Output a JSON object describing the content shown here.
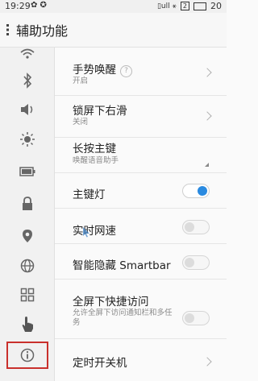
{
  "status_bar": {
    "time": "19:29",
    "notif_glyph": "✿ ✪",
    "signal_text": "▯ull ⚹",
    "sim_badge": "2",
    "battery_level": "20"
  },
  "header": {
    "title": "辅助功能"
  },
  "sidebar": {
    "items": [
      {
        "icon": "wifi-icon"
      },
      {
        "icon": "bluetooth-icon"
      },
      {
        "icon": "volume-icon"
      },
      {
        "icon": "brightness-icon"
      },
      {
        "icon": "battery-icon"
      },
      {
        "icon": "lock-icon"
      },
      {
        "icon": "location-icon"
      },
      {
        "icon": "globe-icon"
      },
      {
        "icon": "apps-grid-icon"
      },
      {
        "icon": "hand-gesture-icon"
      },
      {
        "icon": "info-icon",
        "highlighted": true
      }
    ],
    "highlight_color": "#c9302c"
  },
  "settings": [
    {
      "title": "手势唤醒",
      "subtitle": "开启",
      "control": "chevron",
      "help": "?"
    },
    {
      "title": "锁屏下右滑",
      "subtitle": "关闭",
      "control": "chevron"
    },
    {
      "title": "长按主键",
      "subtitle": "唤醒语音助手",
      "control": "dropdown"
    },
    {
      "title": "主键灯",
      "control": "toggle",
      "on": true
    },
    {
      "title": "实时网速",
      "control": "toggle",
      "on": false
    },
    {
      "title": "智能隐藏 Smartbar",
      "control": "toggle",
      "on": false
    },
    {
      "title": "全屏下快捷访问",
      "subtitle": "允许全屏下访问通知栏和多任务",
      "control": "toggle",
      "on": false
    },
    {
      "title": "定时开关机",
      "control": "chevron"
    }
  ],
  "colors": {
    "accent": "#2a8ae0",
    "highlight_border": "#c9302c"
  }
}
